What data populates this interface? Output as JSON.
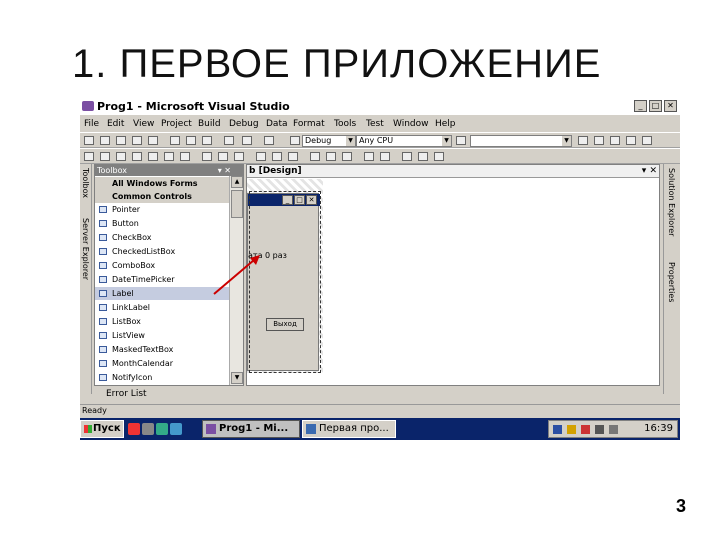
{
  "slide": {
    "title": "1. ПЕРВОЕ  ПРИЛОЖЕНИЕ",
    "page_number": "3"
  },
  "window": {
    "title": "Prog1 - Microsoft Visual Studio",
    "min": "_",
    "max": "□",
    "close": "✕"
  },
  "menu": [
    "File",
    "Edit",
    "View",
    "Project",
    "Build",
    "Debug",
    "Data",
    "Format",
    "Tools",
    "Test",
    "Window",
    "Help"
  ],
  "toolbar": {
    "config": "Debug",
    "platform": "Any CPU"
  },
  "side_tabs": {
    "left_top": "Toolbox",
    "left_bottom": "Server Explorer",
    "right_top": "Solution Explorer",
    "right_bottom": "Properties"
  },
  "toolbox": {
    "header": "Toolbox",
    "all_forms": "All Windows Forms",
    "common": "Common Controls",
    "items": [
      "Pointer",
      "Button",
      "CheckBox",
      "CheckedListBox",
      "ComboBox",
      "DateTimePicker",
      "Label",
      "LinkLabel",
      "ListBox",
      "ListView",
      "MaskedTextBox",
      "MonthCalendar",
      "NotifyIcon"
    ],
    "selected": "Label"
  },
  "designer": {
    "tab": "b [Design]",
    "label_text": "ата 0 раз",
    "button_text": "Выход",
    "form_min": "_",
    "form_max": "□",
    "form_close": "✕"
  },
  "bottom": {
    "error_list": "Error List",
    "status": "Ready"
  },
  "taskbar": {
    "start": "Пуск",
    "tasks": [
      {
        "label": "Prog1 - Mi..."
      },
      {
        "label": "Первая про..."
      }
    ],
    "clock": "16:39"
  },
  "colors": {
    "titlebar_bg": "#ffffff",
    "taskbar": "#0a246a",
    "arrow": "#cc0000"
  }
}
